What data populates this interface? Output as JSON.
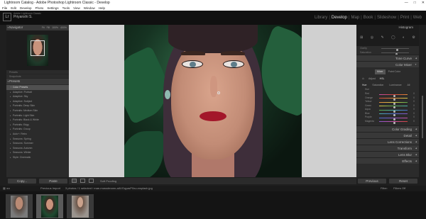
{
  "window": {
    "title": "Lightroom Catalog - Adobe Photoshop Lightroom Classic - Develop",
    "controls": [
      "—",
      "□",
      "✕"
    ]
  },
  "menu": [
    "File",
    "Edit",
    "Develop",
    "Photo",
    "Settings",
    "Tools",
    "View",
    "Window",
    "Help"
  ],
  "identity": {
    "catalog": "Adobe Lightroom Classic",
    "user": "Priyanshi S.",
    "logo": "Lr"
  },
  "modules": [
    "Library",
    "Develop",
    "Map",
    "Book",
    "Slideshow",
    "Print",
    "Web"
  ],
  "active_module": "Develop",
  "left_panel": {
    "navigator": {
      "title": "Navigator",
      "zoom": [
        "Fit",
        "Fill",
        "100%",
        "400%"
      ]
    },
    "snapshots_rows": [
      "Presets",
      "Snapshots"
    ],
    "presets": {
      "title": "Presets",
      "items": [
        {
          "label": "Color Presets",
          "folder": true
        },
        {
          "label": "Adaptive: Portrait",
          "folder": false
        },
        {
          "label": "Adaptive: Sky",
          "folder": false
        },
        {
          "label": "Adaptive: Subject",
          "folder": false
        },
        {
          "label": "Portraits: Deep Skin",
          "folder": false
        },
        {
          "label": "Portraits: Medium Skin",
          "folder": false
        },
        {
          "label": "Portraits: Light Skin",
          "folder": false
        },
        {
          "label": "Portraits: Black & White",
          "folder": false
        },
        {
          "label": "Portraits: Edgy",
          "folder": false
        },
        {
          "label": "Portraits: Group",
          "folder": false
        },
        {
          "label": "Auto+: Retro",
          "folder": false
        },
        {
          "label": "Seasons: Spring",
          "folder": false
        },
        {
          "label": "Seasons: Summer",
          "folder": false
        },
        {
          "label": "Seasons: Autumn",
          "folder": false
        },
        {
          "label": "Seasons: Winter",
          "folder": false
        },
        {
          "label": "Style: Cinematic",
          "folder": false
        }
      ]
    },
    "buttons": {
      "copy": "Copy...",
      "paste": "Paste"
    }
  },
  "toolbar": {
    "soft_proofing": "Soft Proofing"
  },
  "right_panel": {
    "histogram_title": "Histogram",
    "tool_icons": [
      "⊞",
      "◎",
      "✎",
      "◯",
      "◐",
      "⚙"
    ],
    "basic_sliders": [
      {
        "label": "Clarity",
        "value": 0.55
      },
      {
        "label": "Saturation",
        "value": 0.5
      }
    ],
    "sections_top": [
      "Tone Curve",
      "Color Mixer"
    ],
    "mixer": {
      "type": [
        "Mixer",
        "Point Color"
      ],
      "active_type": "Mixer",
      "adjust_label": "Adjust",
      "adjust_value": "HSL",
      "tabs": [
        "Hue",
        "Saturation",
        "Luminance",
        "All"
      ],
      "active_tab": "Hue",
      "sub_label": "Hue",
      "colors": [
        {
          "label": "Red",
          "value": "0",
          "color": "#d0453c"
        },
        {
          "label": "Orange",
          "value": "0",
          "color": "#e0893a"
        },
        {
          "label": "Yellow",
          "value": "0",
          "color": "#d8c94a"
        },
        {
          "label": "Green",
          "value": "0",
          "color": "#58a848"
        },
        {
          "label": "Aqua",
          "value": "0",
          "color": "#4cb0b0"
        },
        {
          "label": "Blue",
          "value": "0",
          "color": "#4a6ed0"
        },
        {
          "label": "Purple",
          "value": "0",
          "color": "#8a56c8"
        },
        {
          "label": "Magenta",
          "value": "0",
          "color": "#c84fa6"
        }
      ]
    },
    "sections_bottom": [
      "Color Grading",
      "Detail",
      "Lens Corrections",
      "Transform",
      "Lens Blur",
      "Effects"
    ],
    "buttons": {
      "previous": "Previous",
      "reset": "Reset"
    }
  },
  "filmstrip": {
    "source": "Previous Import",
    "info": "3 photos / 1 selected / mae-mussdmann-aAVGqyasP0w-unsplash.jpg",
    "filter_label": "Filter:",
    "filter_value": "Filters Off"
  }
}
